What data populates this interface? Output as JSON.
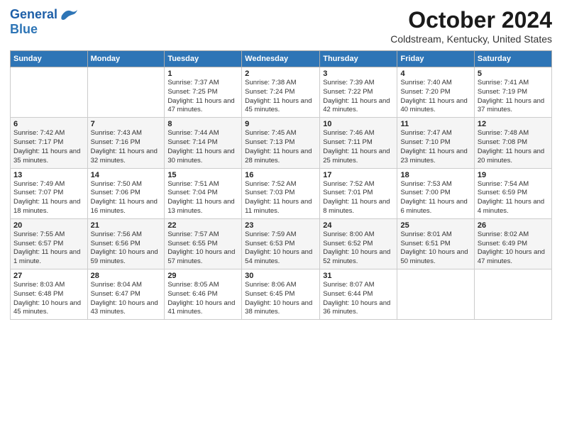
{
  "header": {
    "logo_line1": "General",
    "logo_line2": "Blue",
    "month": "October 2024",
    "location": "Coldstream, Kentucky, United States"
  },
  "weekdays": [
    "Sunday",
    "Monday",
    "Tuesday",
    "Wednesday",
    "Thursday",
    "Friday",
    "Saturday"
  ],
  "weeks": [
    [
      {
        "day": "",
        "info": ""
      },
      {
        "day": "",
        "info": ""
      },
      {
        "day": "1",
        "info": "Sunrise: 7:37 AM\nSunset: 7:25 PM\nDaylight: 11 hours and 47 minutes."
      },
      {
        "day": "2",
        "info": "Sunrise: 7:38 AM\nSunset: 7:24 PM\nDaylight: 11 hours and 45 minutes."
      },
      {
        "day": "3",
        "info": "Sunrise: 7:39 AM\nSunset: 7:22 PM\nDaylight: 11 hours and 42 minutes."
      },
      {
        "day": "4",
        "info": "Sunrise: 7:40 AM\nSunset: 7:20 PM\nDaylight: 11 hours and 40 minutes."
      },
      {
        "day": "5",
        "info": "Sunrise: 7:41 AM\nSunset: 7:19 PM\nDaylight: 11 hours and 37 minutes."
      }
    ],
    [
      {
        "day": "6",
        "info": "Sunrise: 7:42 AM\nSunset: 7:17 PM\nDaylight: 11 hours and 35 minutes."
      },
      {
        "day": "7",
        "info": "Sunrise: 7:43 AM\nSunset: 7:16 PM\nDaylight: 11 hours and 32 minutes."
      },
      {
        "day": "8",
        "info": "Sunrise: 7:44 AM\nSunset: 7:14 PM\nDaylight: 11 hours and 30 minutes."
      },
      {
        "day": "9",
        "info": "Sunrise: 7:45 AM\nSunset: 7:13 PM\nDaylight: 11 hours and 28 minutes."
      },
      {
        "day": "10",
        "info": "Sunrise: 7:46 AM\nSunset: 7:11 PM\nDaylight: 11 hours and 25 minutes."
      },
      {
        "day": "11",
        "info": "Sunrise: 7:47 AM\nSunset: 7:10 PM\nDaylight: 11 hours and 23 minutes."
      },
      {
        "day": "12",
        "info": "Sunrise: 7:48 AM\nSunset: 7:08 PM\nDaylight: 11 hours and 20 minutes."
      }
    ],
    [
      {
        "day": "13",
        "info": "Sunrise: 7:49 AM\nSunset: 7:07 PM\nDaylight: 11 hours and 18 minutes."
      },
      {
        "day": "14",
        "info": "Sunrise: 7:50 AM\nSunset: 7:06 PM\nDaylight: 11 hours and 16 minutes."
      },
      {
        "day": "15",
        "info": "Sunrise: 7:51 AM\nSunset: 7:04 PM\nDaylight: 11 hours and 13 minutes."
      },
      {
        "day": "16",
        "info": "Sunrise: 7:52 AM\nSunset: 7:03 PM\nDaylight: 11 hours and 11 minutes."
      },
      {
        "day": "17",
        "info": "Sunrise: 7:52 AM\nSunset: 7:01 PM\nDaylight: 11 hours and 8 minutes."
      },
      {
        "day": "18",
        "info": "Sunrise: 7:53 AM\nSunset: 7:00 PM\nDaylight: 11 hours and 6 minutes."
      },
      {
        "day": "19",
        "info": "Sunrise: 7:54 AM\nSunset: 6:59 PM\nDaylight: 11 hours and 4 minutes."
      }
    ],
    [
      {
        "day": "20",
        "info": "Sunrise: 7:55 AM\nSunset: 6:57 PM\nDaylight: 11 hours and 1 minute."
      },
      {
        "day": "21",
        "info": "Sunrise: 7:56 AM\nSunset: 6:56 PM\nDaylight: 10 hours and 59 minutes."
      },
      {
        "day": "22",
        "info": "Sunrise: 7:57 AM\nSunset: 6:55 PM\nDaylight: 10 hours and 57 minutes."
      },
      {
        "day": "23",
        "info": "Sunrise: 7:59 AM\nSunset: 6:53 PM\nDaylight: 10 hours and 54 minutes."
      },
      {
        "day": "24",
        "info": "Sunrise: 8:00 AM\nSunset: 6:52 PM\nDaylight: 10 hours and 52 minutes."
      },
      {
        "day": "25",
        "info": "Sunrise: 8:01 AM\nSunset: 6:51 PM\nDaylight: 10 hours and 50 minutes."
      },
      {
        "day": "26",
        "info": "Sunrise: 8:02 AM\nSunset: 6:49 PM\nDaylight: 10 hours and 47 minutes."
      }
    ],
    [
      {
        "day": "27",
        "info": "Sunrise: 8:03 AM\nSunset: 6:48 PM\nDaylight: 10 hours and 45 minutes."
      },
      {
        "day": "28",
        "info": "Sunrise: 8:04 AM\nSunset: 6:47 PM\nDaylight: 10 hours and 43 minutes."
      },
      {
        "day": "29",
        "info": "Sunrise: 8:05 AM\nSunset: 6:46 PM\nDaylight: 10 hours and 41 minutes."
      },
      {
        "day": "30",
        "info": "Sunrise: 8:06 AM\nSunset: 6:45 PM\nDaylight: 10 hours and 38 minutes."
      },
      {
        "day": "31",
        "info": "Sunrise: 8:07 AM\nSunset: 6:44 PM\nDaylight: 10 hours and 36 minutes."
      },
      {
        "day": "",
        "info": ""
      },
      {
        "day": "",
        "info": ""
      }
    ]
  ]
}
